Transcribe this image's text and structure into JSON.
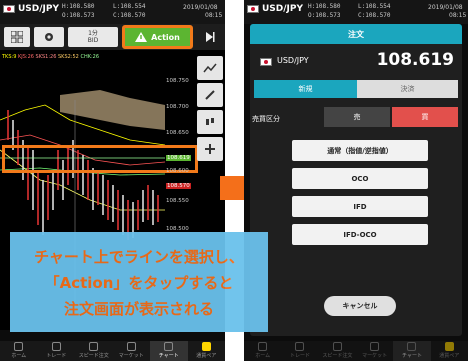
{
  "left": {
    "header": {
      "pair": "USD/JPY",
      "high": "H:108.580",
      "low": "L:108.554",
      "open": "O:108.573",
      "close": "C:108.570",
      "date": "2019/01/08",
      "time": "08:15"
    },
    "toolbar": {
      "timeframe_value": "1分",
      "timeframe_label": "BID",
      "action_label": "Action"
    },
    "indicators": [
      "TKS:9",
      "KJS:26",
      "SKS1:26",
      "SKS2:52",
      "CHK:26"
    ],
    "price_ticks": [
      "108.750",
      "108.700",
      "108.650",
      "108.619",
      "108.600",
      "108.570",
      "108.550",
      "108.500"
    ],
    "highlight_price": "108.619"
  },
  "right": {
    "header": {
      "pair": "USD/JPY",
      "high": "H:108.580",
      "low": "L:108.554",
      "open": "O:108.573",
      "close": "C:108.570",
      "date": "2019/01/08",
      "time": "08:15"
    },
    "dialog": {
      "title": "注文",
      "pair": "USD/JPY",
      "price": "108.619",
      "tab_new": "新規",
      "tab_settle": "決済",
      "trade_label": "売買区分",
      "sell": "売",
      "buy": "買",
      "order_types": [
        "通常（指値/逆指値）",
        "OCO",
        "IFD",
        "IFD-OCO"
      ],
      "cancel": "キャンセル"
    }
  },
  "tabbar": [
    "ホーム",
    "トレード",
    "スピード注文",
    "マーケット",
    "チャート",
    "通貨ペア"
  ],
  "callout_lines": [
    "チャート上でラインを選択し、",
    "「Action」をタップすると",
    "注文画面が表示される"
  ],
  "colors": {
    "action_green": "#5cb531",
    "highlight_orange": "#f27a1a",
    "teal": "#1ba6be",
    "buy_red": "#e2504c",
    "callout_blue": "#6ac1ec",
    "callout_text": "#f46f1a"
  }
}
